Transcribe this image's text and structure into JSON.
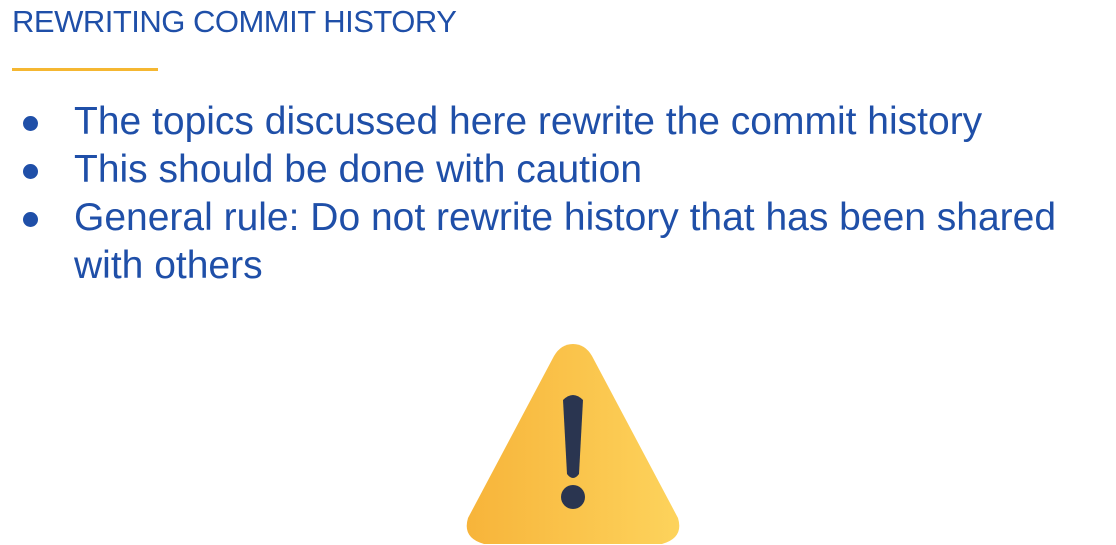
{
  "slide": {
    "title": "REWRITING COMMIT HISTORY",
    "bullets": [
      "The topics discussed here rewrite the commit history",
      "This should be done with caution",
      "General rule: Do not rewrite history that has been shared with others"
    ],
    "icon": "warning-icon"
  },
  "colors": {
    "text": "#1f4fa8",
    "accent_underline": "#f5b731",
    "warning_fill": "#fbc84a",
    "warning_mark": "#2a3550"
  }
}
